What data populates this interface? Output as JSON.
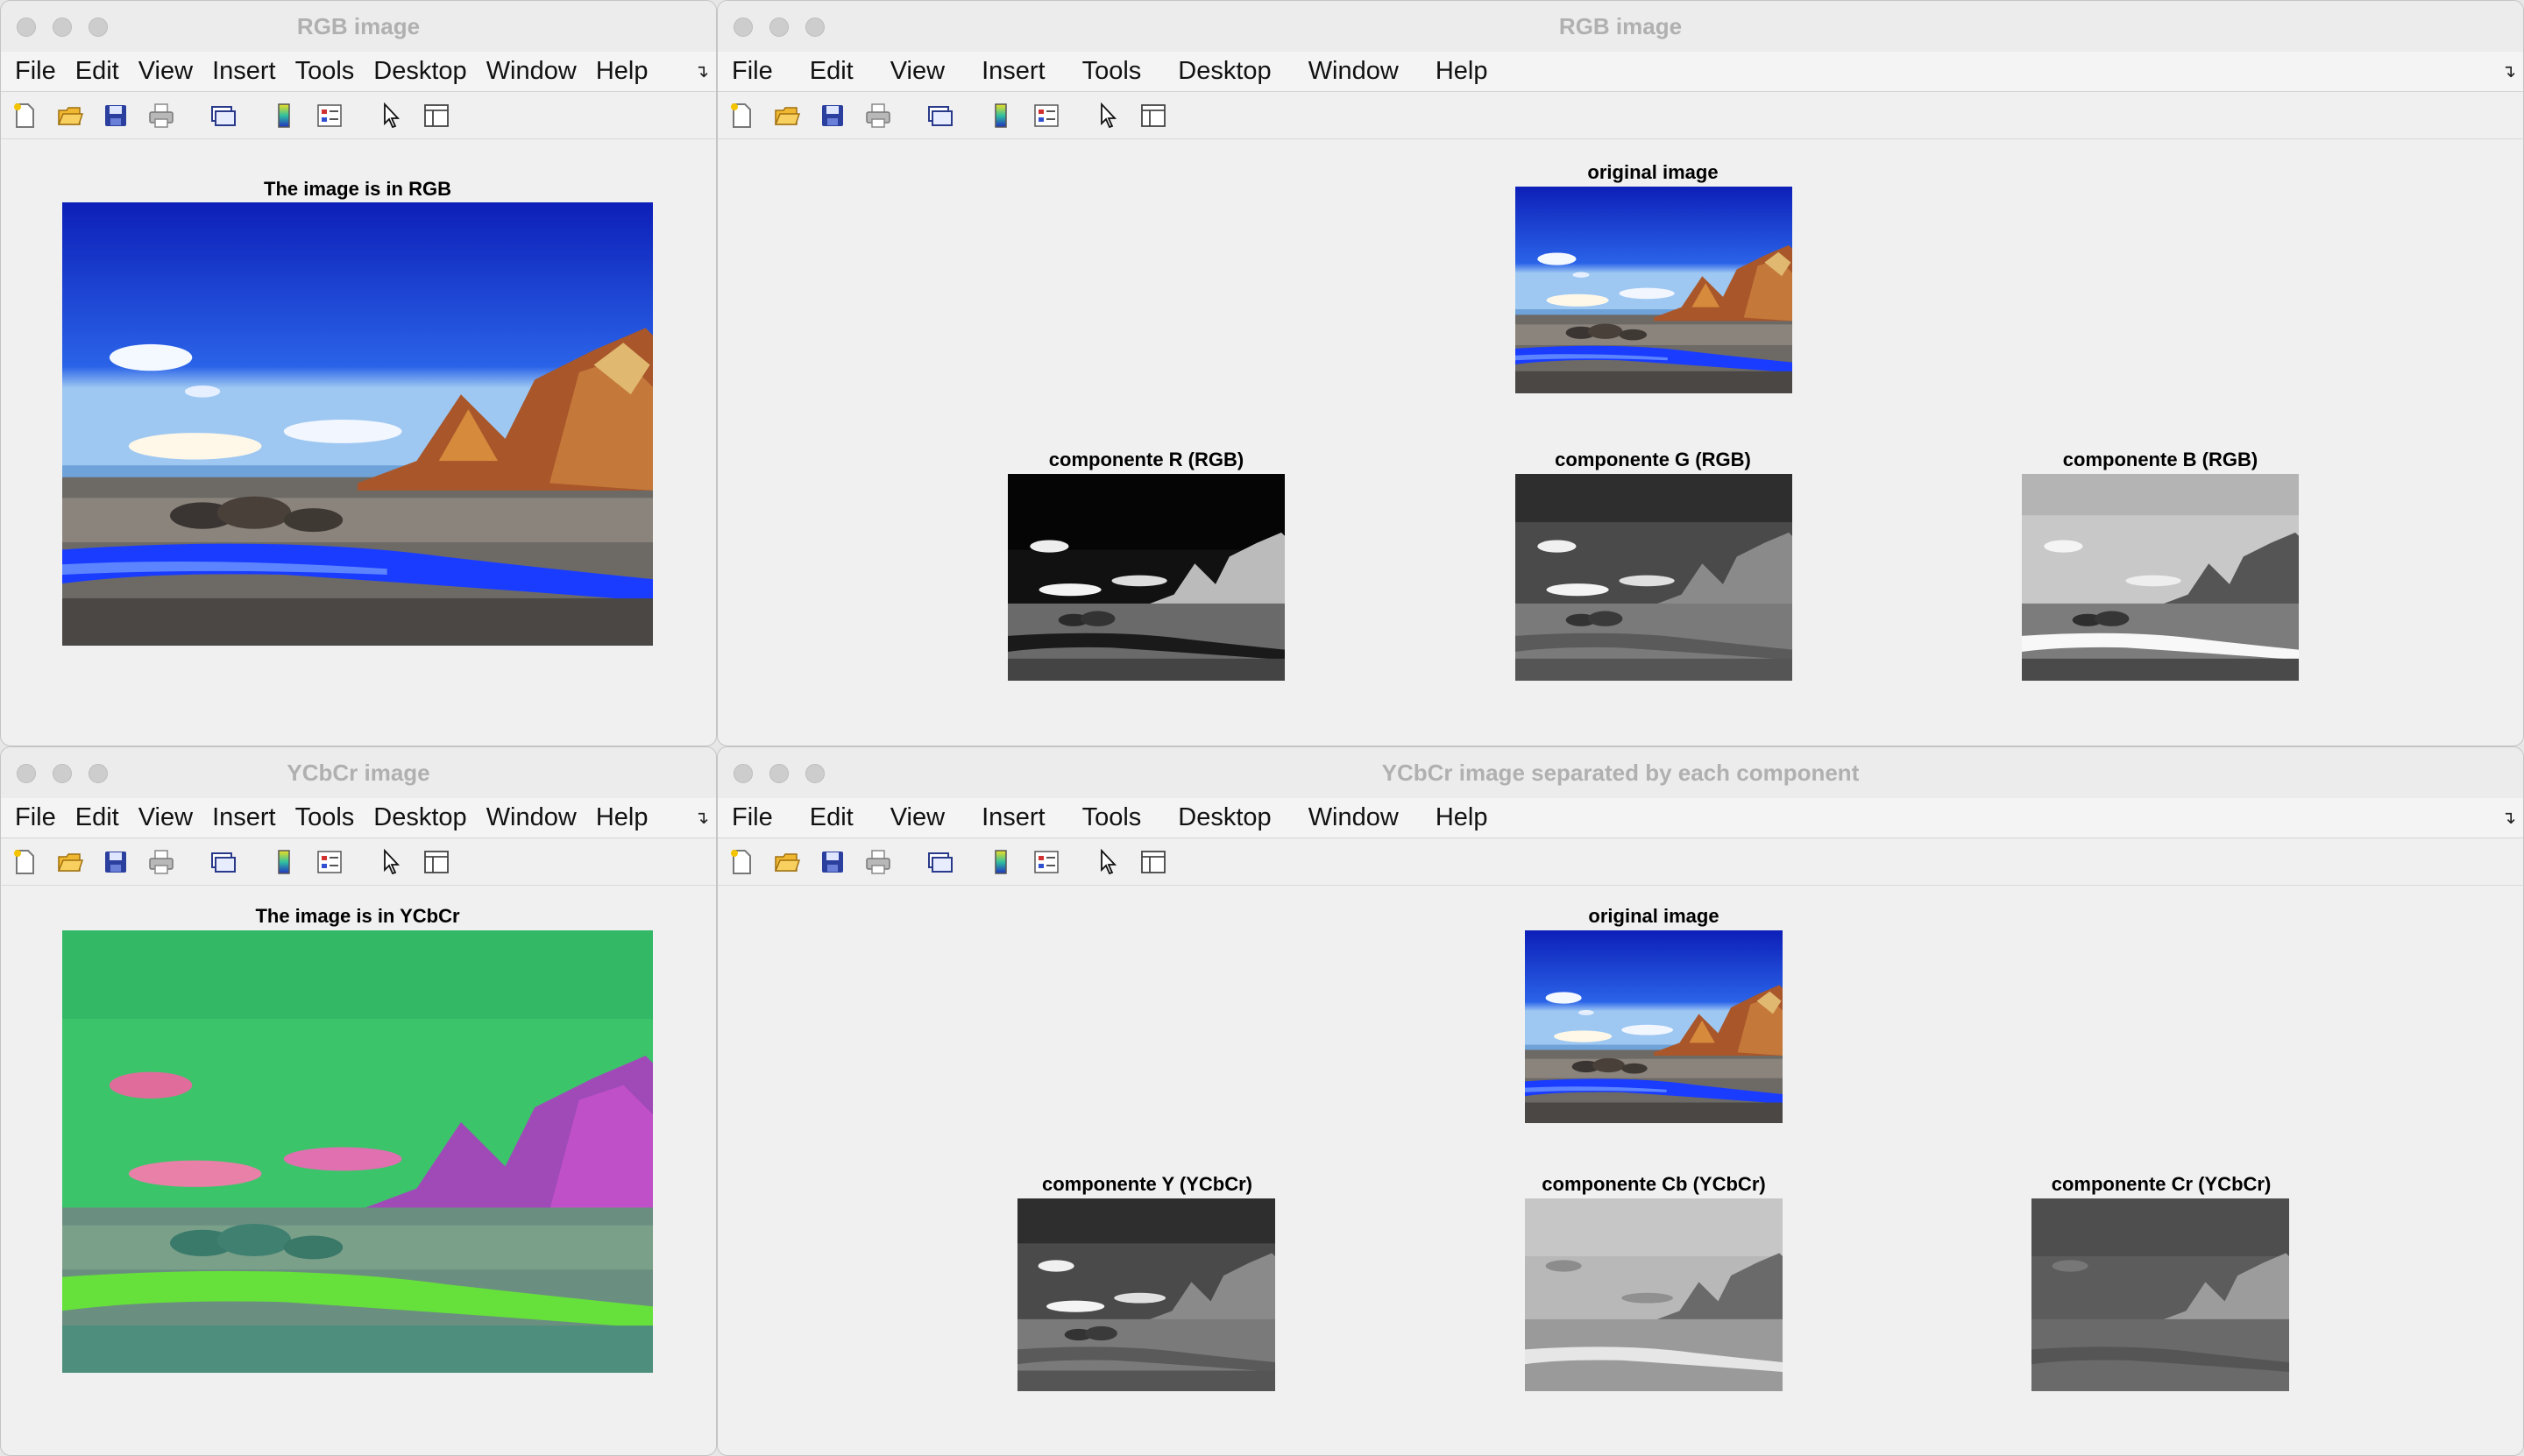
{
  "menu": [
    "File",
    "Edit",
    "View",
    "Insert",
    "Tools",
    "Desktop",
    "Window",
    "Help"
  ],
  "toolbar_icons": [
    "new-figure-icon",
    "open-file-icon",
    "save-icon",
    "print-icon",
    "link-plot-icon",
    "colorbar-icon",
    "legend-icon",
    "edit-plot-arrow-icon",
    "property-inspector-icon"
  ],
  "windows": {
    "rgb_single": {
      "title": "RGB image",
      "axes_title": "The image is in RGB"
    },
    "rgb_components": {
      "title": "RGB image",
      "original_title": "original image",
      "components": [
        "componente R (RGB)",
        "componente G (RGB)",
        "componente B (RGB)"
      ]
    },
    "ycbcr_single": {
      "title": "YCbCr image",
      "axes_title": "The image is in YCbCr"
    },
    "ycbcr_components": {
      "title": "YCbCr image separated by each component",
      "original_title": "original image",
      "components": [
        "componente Y (YCbCr)",
        "componente Cb (YCbCr)",
        "componente Cr (YCbCr)"
      ]
    }
  },
  "colors": {
    "titlebar_text": "#b0b0b0",
    "window_bg": "#f0f0f0",
    "rgb_sky": "#1a2fd0",
    "ycbcr_green": "#3cc46a",
    "ycbcr_magenta": "#c04ac8"
  }
}
